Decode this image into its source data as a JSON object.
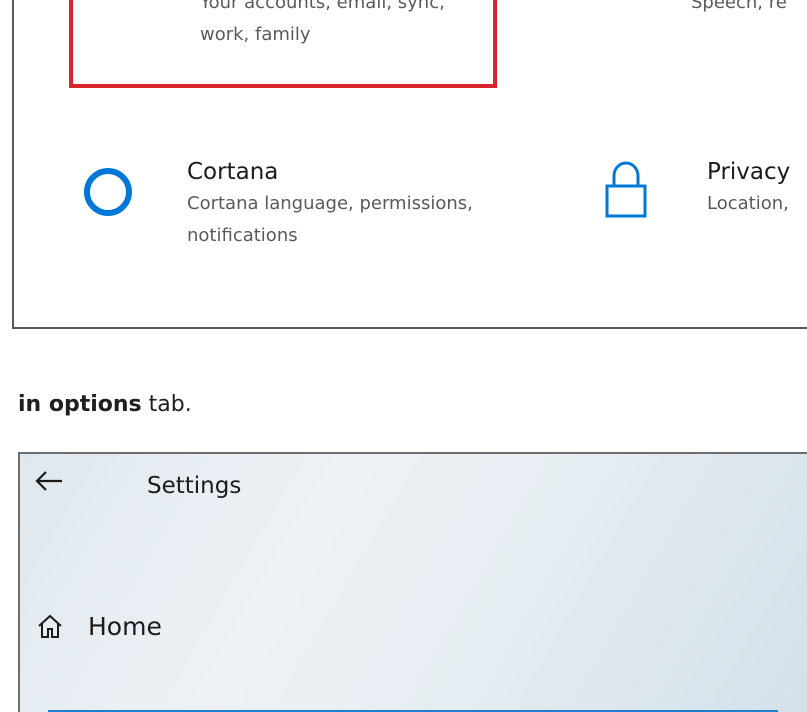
{
  "top_screenshot": {
    "tiles": [
      {
        "icon": "accounts-person-icon",
        "title": "",
        "description_line1": "Your accounts, email, sync,",
        "description_line2": "work, family"
      },
      {
        "icon": "time-language-icon",
        "title": "",
        "description_line1": "Speech, re",
        "description_line2": ""
      },
      {
        "icon": "cortana-circle-icon",
        "title": "Cortana",
        "description_line1": "Cortana language, permissions,",
        "description_line2": "notifications"
      },
      {
        "icon": "privacy-lock-icon",
        "title": "Privacy",
        "description_line1": "Location,",
        "description_line2": ""
      }
    ],
    "highlight_color": "#d9242b",
    "accent_color": "#0078d7"
  },
  "caption": {
    "bold_text": "in options",
    "rest_text": " tab."
  },
  "bottom_screenshot": {
    "window_title": "Settings",
    "home_label": "Home",
    "accent_color": "#1e7fd1"
  }
}
